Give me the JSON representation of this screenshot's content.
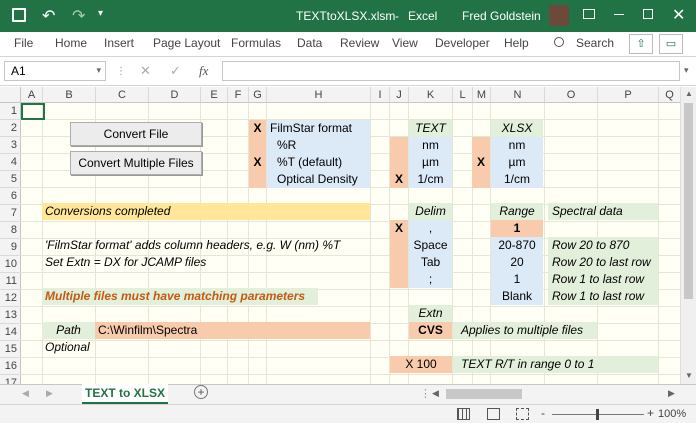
{
  "title": {
    "file": "TEXTtoXLSX.xlsm",
    "sep": "-",
    "app": "Excel",
    "user": "Fred Goldstein"
  },
  "colors": {
    "titlebar": "#217346",
    "blue_cell": "#dce9f7",
    "peach_cell": "#f8cbad",
    "green_cell": "#e2efda",
    "yellow_cell": "#ffe699",
    "orange_text": "#c55a11"
  },
  "ribbon": {
    "tabs": [
      "File",
      "Home",
      "Insert",
      "Page Layout",
      "Formulas",
      "Data",
      "Review",
      "View",
      "Developer",
      "Help"
    ],
    "search": "Search"
  },
  "formula": {
    "namebox": "A1",
    "fx": "fx",
    "value": ""
  },
  "columns": [
    "A",
    "B",
    "C",
    "D",
    "E",
    "F",
    "G",
    "H",
    "I",
    "J",
    "K",
    "L",
    "M",
    "N",
    "O",
    "P",
    "Q"
  ],
  "rows": [
    "1",
    "2",
    "3",
    "4",
    "5",
    "6",
    "7",
    "8",
    "9",
    "10",
    "11",
    "12",
    "13",
    "14",
    "15",
    "16",
    "17"
  ],
  "buttons": {
    "convert_file": "Convert File",
    "convert_multiple": "Convert Multiple Files"
  },
  "format": {
    "x_r2": "X",
    "filmstar": "FilmStar format",
    "r": "%R",
    "x_r4": "X",
    "t": "%T (default)",
    "od": "Optical Density"
  },
  "text_units": {
    "header": "TEXT",
    "nm": "nm",
    "um": "µm",
    "x_r5": "X",
    "cm": "1/cm"
  },
  "xlsx_units": {
    "header": "XLSX",
    "nm": "nm",
    "x_r4": "X",
    "um": "µm",
    "cm": "1/cm"
  },
  "notes": {
    "completed": "Conversions completed",
    "filmstar_note": "'FilmStar format' adds column headers, e.g. W (nm)  %T",
    "extn_note": "Set Extn = DX for JCAMP files",
    "multiple": "Multiple files must have matching parameters"
  },
  "delim": {
    "header": "Delim",
    "x": "X",
    "comma": ",",
    "space": "Space",
    "tab": "Tab",
    "semicolon": ";"
  },
  "range": {
    "header": "Range",
    "sel": "1",
    "r1": "20-870",
    "r2": "20",
    "r3": "1",
    "r4": "Blank"
  },
  "spectral": {
    "header": "Spectral data",
    "r1": "Row 20 to 870",
    "r2": "Row 20 to last row",
    "r3": "Row 1 to last row",
    "r4": "Row 1 to last row"
  },
  "extn": {
    "header": "Extn",
    "value": "CVS",
    "note": "Applies to multiple files"
  },
  "path": {
    "label": "Path",
    "value": "C:\\Winfilm\\Spectra",
    "optional": "Optional"
  },
  "scale": {
    "value": "X 100",
    "note": "TEXT R/T in range 0 to 1"
  },
  "sheet": {
    "tab": "TEXT to XLSX",
    "add": "+"
  },
  "status": {
    "zoom": "100%",
    "minus": "-",
    "plus": "+"
  }
}
